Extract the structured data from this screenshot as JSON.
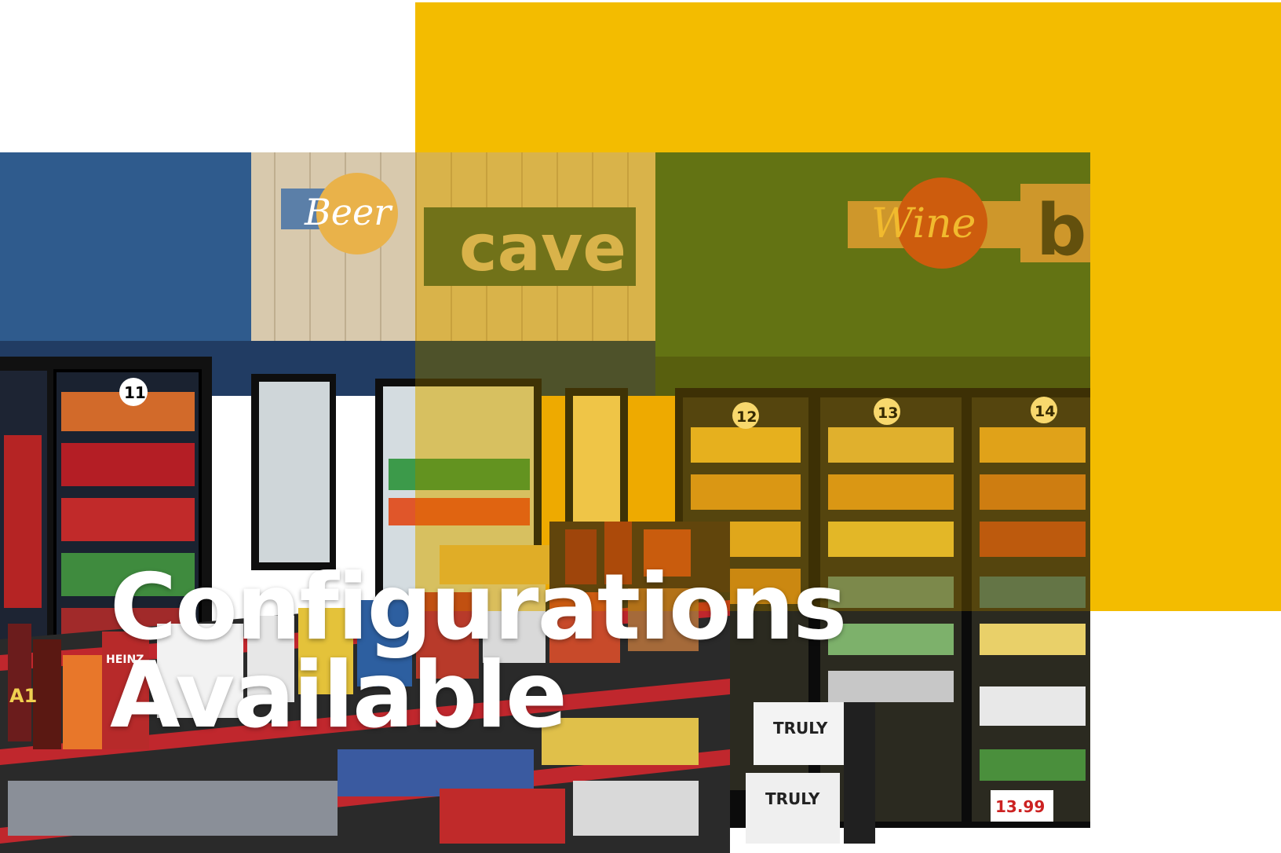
{
  "headline": {
    "line1": "Configurations",
    "line2": "Available"
  },
  "photo_signage": {
    "beer_cave_script": "Beer",
    "beer_cave_block": "cave",
    "wine_script": "Wine",
    "wine_block": "b"
  },
  "door_numbers": [
    "11",
    "12",
    "13",
    "14"
  ],
  "product_labels": {
    "truly": "TRULY",
    "heinz": "HEINZ",
    "a1": "A1",
    "price": "13.99"
  },
  "colors": {
    "accent": "#f3bc00",
    "background": "#ffffff",
    "headline": "#ffffff",
    "wall_blue": "#2d4f7c",
    "wall_green": "#4d6a1f"
  }
}
